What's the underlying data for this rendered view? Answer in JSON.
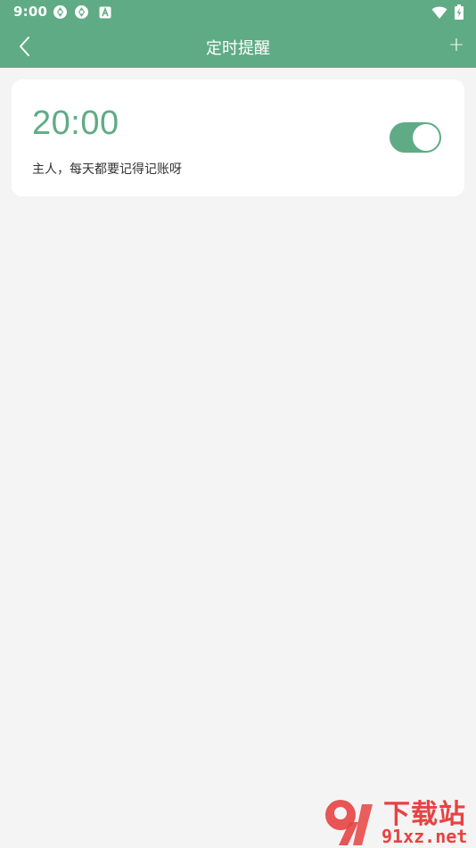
{
  "status_bar": {
    "time": "9:00",
    "icons": [
      "app-notification-icon",
      "app-notification-icon",
      "text-a-icon"
    ],
    "right_icons": [
      "wifi-icon",
      "battery-charging-icon"
    ]
  },
  "app_bar": {
    "title": "定时提醒",
    "add_label": "+",
    "back_icon": "chevron-left-icon"
  },
  "reminders": [
    {
      "time": "20:00",
      "message": "主人，每天都要记得记账呀",
      "enabled": true
    }
  ],
  "watermark": {
    "top_text": "下载站",
    "bottom_text": "91xz.net"
  },
  "colors": {
    "primary": "#5fab85",
    "background": "#f4f4f4",
    "card": "#ffffff",
    "watermark": "#e84242"
  }
}
